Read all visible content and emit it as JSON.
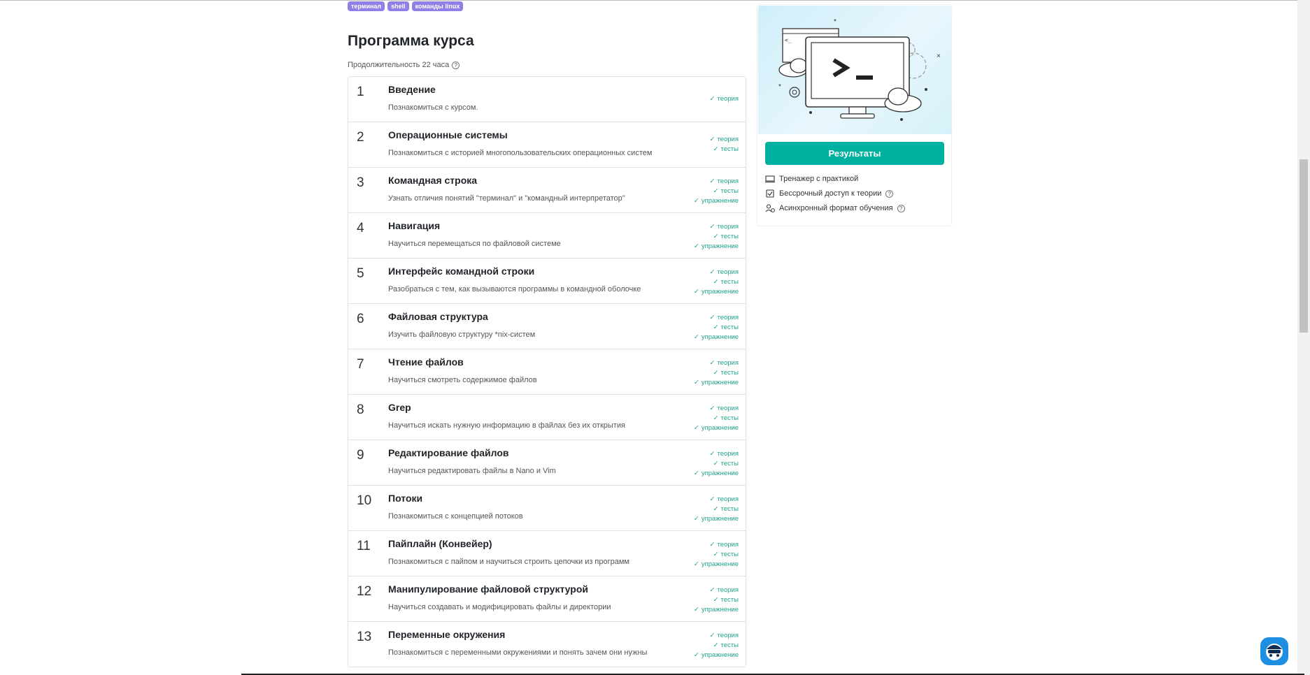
{
  "tags": [
    "терминал",
    "shell",
    "команды linux"
  ],
  "program": {
    "title": "Программа курса",
    "duration": "Продолжительность 22 часа"
  },
  "lessons": [
    {
      "num": "1",
      "title": "Введение",
      "desc": "Познакомиться с курсом.",
      "badges": [
        "теория"
      ]
    },
    {
      "num": "2",
      "title": "Операционные системы",
      "desc": "Познакомиться с историей многопользовательских операционных систем",
      "badges": [
        "теория",
        "тесты"
      ]
    },
    {
      "num": "3",
      "title": "Командная строка",
      "desc": "Узнать отличия понятий \"терминал\" и \"командный интерпретатор\"",
      "badges": [
        "теория",
        "тесты",
        "упражнение"
      ]
    },
    {
      "num": "4",
      "title": "Навигация",
      "desc": "Научиться перемещаться по файловой системе",
      "badges": [
        "теория",
        "тесты",
        "упражнение"
      ]
    },
    {
      "num": "5",
      "title": "Интерфейс командной строки",
      "desc": "Разобраться с тем, как вызываются программы в командной оболочке",
      "badges": [
        "теория",
        "тесты",
        "упражнение"
      ]
    },
    {
      "num": "6",
      "title": "Файловая структура",
      "desc": "Изучить файловую структуру *nix-систем",
      "badges": [
        "теория",
        "тесты",
        "упражнение"
      ]
    },
    {
      "num": "7",
      "title": "Чтение файлов",
      "desc": "Научиться смотреть содержимое файлов",
      "badges": [
        "теория",
        "тесты",
        "упражнение"
      ]
    },
    {
      "num": "8",
      "title": "Grep",
      "desc": "Научиться искать нужную информацию в файлах без их открытия",
      "badges": [
        "теория",
        "тесты",
        "упражнение"
      ]
    },
    {
      "num": "9",
      "title": "Редактирование файлов",
      "desc": "Научиться редактировать файлы в Nano и Vim",
      "badges": [
        "теория",
        "тесты",
        "упражнение"
      ]
    },
    {
      "num": "10",
      "title": "Потоки",
      "desc": "Познакомиться с концепцией потоков",
      "badges": [
        "теория",
        "тесты",
        "упражнение"
      ]
    },
    {
      "num": "11",
      "title": "Пайплайн (Конвейер)",
      "desc": "Познакомиться с пайпом и научиться строить цепочки из программ",
      "badges": [
        "теория",
        "тесты",
        "упражнение"
      ]
    },
    {
      "num": "12",
      "title": "Манипулирование файловой структурой",
      "desc": "Научиться создавать и модифицировать файлы и директории",
      "badges": [
        "теория",
        "тесты",
        "упражнение"
      ]
    },
    {
      "num": "13",
      "title": "Переменные окружения",
      "desc": "Познакомиться с переменными окружениями и понять зачем они нужны",
      "badges": [
        "теория",
        "тесты",
        "упражнение"
      ]
    }
  ],
  "sidebar": {
    "button_label": "Результаты",
    "features": [
      {
        "label": "Тренажер с практикой",
        "icon": "keyboard-icon",
        "help": false
      },
      {
        "label": "Бессрочный доступ к теории",
        "icon": "checkbox-icon",
        "help": true
      },
      {
        "label": "Асинхронный формат обучения",
        "icon": "user-clock-icon",
        "help": true
      }
    ]
  },
  "colors": {
    "accent": "#00b0a0",
    "tag": "#8e80e6",
    "badge_text": "#20a38a"
  }
}
